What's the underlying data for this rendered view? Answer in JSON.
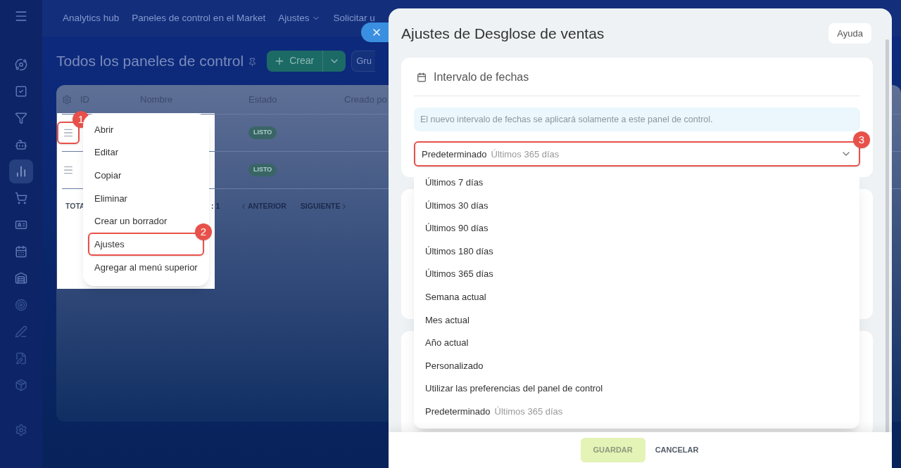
{
  "sidebar": {
    "items": [
      {
        "selected": false
      },
      {
        "selected": false
      },
      {
        "selected": false
      },
      {
        "selected": false
      },
      {
        "selected": true
      },
      {
        "selected": false
      },
      {
        "selected": false
      },
      {
        "selected": false
      },
      {
        "selected": false
      },
      {
        "selected": false
      },
      {
        "selected": false
      },
      {
        "selected": false
      },
      {
        "selected": false
      },
      {
        "selected": false
      }
    ]
  },
  "top_nav": [
    {
      "label": "Analytics hub",
      "dropdown": false
    },
    {
      "label": "Paneles de control en el Market",
      "dropdown": false
    },
    {
      "label": "Ajustes",
      "dropdown": true
    },
    {
      "label": "Solicitar u",
      "dropdown": false
    }
  ],
  "page": {
    "title": "Todos los paneles de control",
    "create_button": "Crear",
    "group_button": "Gru"
  },
  "table": {
    "columns": [
      "ID",
      "Nombre",
      "Estado",
      "Creado po"
    ],
    "rows": [
      {
        "status": "LISTO",
        "highlighted": true,
        "marker": "1"
      },
      {
        "status": "LISTO",
        "highlighted": false
      }
    ],
    "footer": {
      "total": "TOTA",
      "count": ": 1",
      "prev": "ANTERIOR",
      "next": "SIGUIENTE"
    }
  },
  "context_menu": {
    "marker": "2",
    "items": [
      {
        "label": "Abrir",
        "highlighted": false
      },
      {
        "label": "Editar",
        "highlighted": false
      },
      {
        "label": "Copiar",
        "highlighted": false
      },
      {
        "label": "Eliminar",
        "highlighted": false
      },
      {
        "label": "Crear un borrador",
        "highlighted": false
      },
      {
        "label": "Ajustes",
        "highlighted": true
      },
      {
        "label": "Agregar al menú superior",
        "highlighted": false
      }
    ]
  },
  "panel": {
    "title": "Ajustes de Desglose de ventas",
    "help_button": "Ayuda",
    "date_card": {
      "heading": "Intervalo de fechas",
      "info": "El nuevo intervalo de fechas se aplicará solamente a este panel de control.",
      "select": {
        "value": "Predeterminado",
        "hint": "Últimos 365 días",
        "highlighted": true,
        "marker": "3"
      },
      "options": [
        {
          "label": "Últimos 7 días"
        },
        {
          "label": "Últimos 30 días"
        },
        {
          "label": "Últimos 90 días"
        },
        {
          "label": "Últimos 180 días"
        },
        {
          "label": "Últimos 365 días"
        },
        {
          "label": "Semana actual"
        },
        {
          "label": "Mes actual"
        },
        {
          "label": "Año actual"
        },
        {
          "label": "Personalizado"
        },
        {
          "label": "Utilizar las preferencias del panel de control"
        },
        {
          "label": "Predeterminado",
          "hint": "Últimos 365 días"
        }
      ]
    },
    "footer": {
      "save": {
        "label": "GUARDAR",
        "disabled": true
      },
      "cancel": "CANCELAR"
    }
  }
}
